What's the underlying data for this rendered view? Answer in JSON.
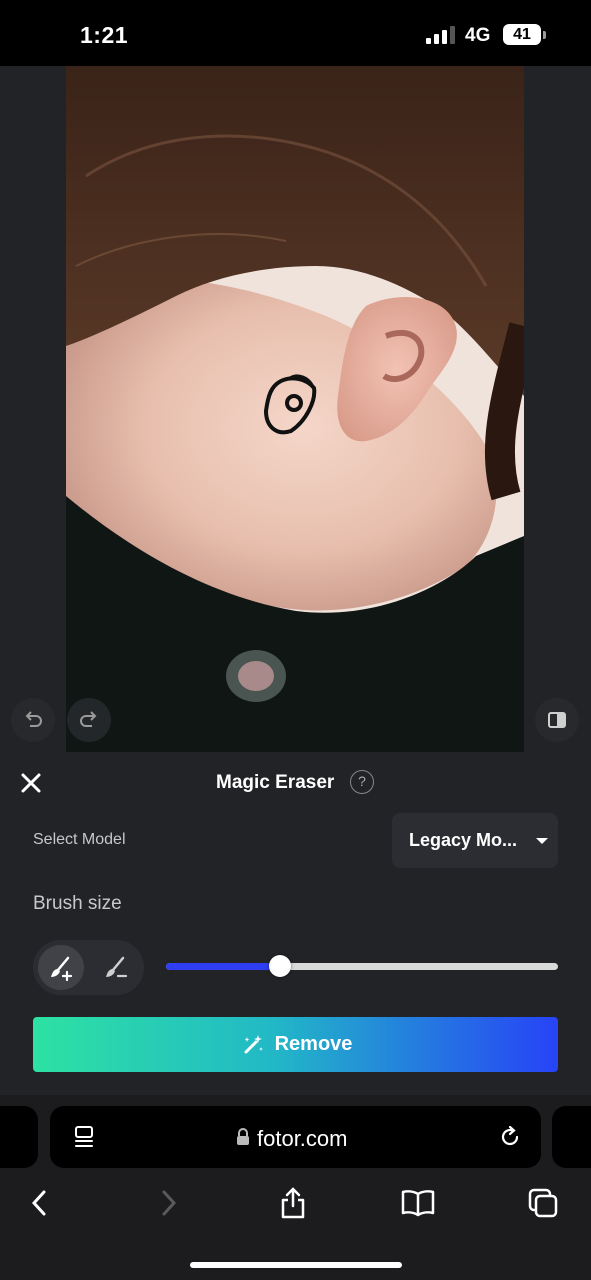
{
  "status_bar": {
    "time": "1:21",
    "network": "4G",
    "battery": "41"
  },
  "editor": {
    "undo_icon": "undo-icon",
    "redo_icon": "redo-icon",
    "compare_icon": "compare-icon"
  },
  "panel": {
    "title": "Magic Eraser",
    "help": "?",
    "select_label": "Select Model",
    "model_value": "Legacy Mo...",
    "brush_label": "Brush size",
    "brush_size_fraction": 0.29,
    "remove_label": "Remove"
  },
  "browser": {
    "url": "fotor.com"
  },
  "colors": {
    "accent_blue": "#2e3ef0",
    "gradient_start": "#2de2a2",
    "gradient_end": "#2743f7"
  }
}
